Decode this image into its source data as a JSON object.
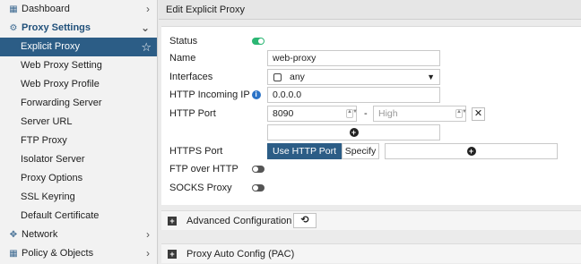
{
  "sidebar": {
    "items": [
      {
        "label": "Dashboard",
        "icon": "dashboard-icon",
        "type": "section-collapsed"
      },
      {
        "label": "Proxy Settings",
        "icon": "gear-icon",
        "type": "section-open"
      },
      {
        "label": "Explicit Proxy",
        "type": "active"
      },
      {
        "label": "Web Proxy Setting"
      },
      {
        "label": "Web Proxy Profile"
      },
      {
        "label": "Forwarding Server"
      },
      {
        "label": "Server URL"
      },
      {
        "label": "FTP Proxy"
      },
      {
        "label": "Isolator Server"
      },
      {
        "label": "Proxy Options"
      },
      {
        "label": "SSL Keyring"
      },
      {
        "label": "Default Certificate"
      },
      {
        "label": "Network",
        "icon": "network-icon",
        "type": "section-collapsed"
      },
      {
        "label": "Policy & Objects",
        "icon": "policy-icon",
        "type": "section-collapsed"
      }
    ]
  },
  "header": {
    "title": "Edit Explicit Proxy"
  },
  "form": {
    "status": {
      "label": "Status",
      "enabled": true
    },
    "name": {
      "label": "Name",
      "value": "web-proxy"
    },
    "interfaces": {
      "label": "Interfaces",
      "value": "any"
    },
    "http_incoming_ip": {
      "label": "HTTP Incoming IP",
      "value": "0.0.0.0"
    },
    "http_port": {
      "label": "HTTP Port",
      "low": "8090",
      "high_placeholder": "High",
      "separator": "-"
    },
    "https_port": {
      "label": "HTTPS Port",
      "options": [
        "Use HTTP Port",
        "Specify"
      ],
      "selected": "Use HTTP Port"
    },
    "ftp_over_http": {
      "label": "FTP over HTTP",
      "enabled": false
    },
    "socks_proxy": {
      "label": "SOCKS Proxy",
      "enabled": false
    }
  },
  "sections": {
    "advanced": {
      "label": "Advanced Configuration"
    },
    "pac": {
      "label": "Proxy Auto Config (PAC)"
    }
  },
  "colors": {
    "accent": "#2c5d86",
    "toggle_on": "#2bb673",
    "info": "#2b73c7"
  }
}
